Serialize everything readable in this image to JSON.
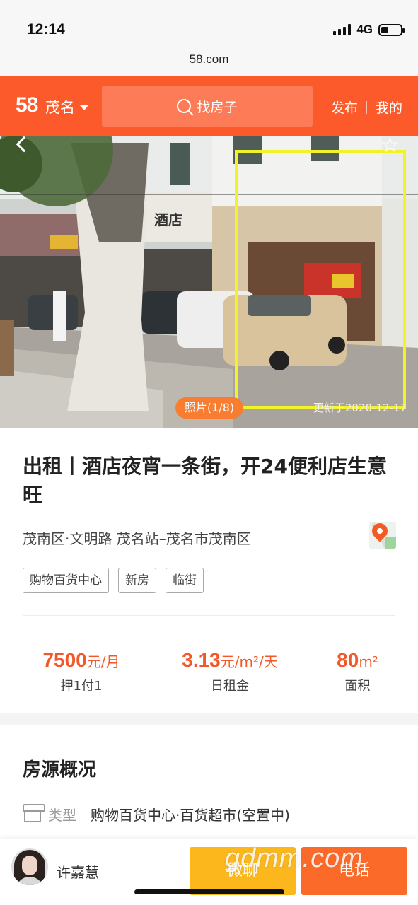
{
  "status": {
    "time": "12:14",
    "network": "4G",
    "battery_level": 0.4
  },
  "browser": {
    "url": "58.com"
  },
  "header": {
    "logo": "58",
    "city": "茂名",
    "search_placeholder": "找房子",
    "publish": "发布",
    "mine": "我的",
    "accent": "#fc5a2a"
  },
  "photo": {
    "counter": "照片(1/8)",
    "updated": "更新于2020-12-17",
    "sign_text": "酒店"
  },
  "listing": {
    "title": "出租丨酒店夜宵一条街，开24便利店生意旺",
    "address": "茂南区·文明路 茂名站–茂名市茂南区",
    "tags": [
      "购物百货中心",
      "新房",
      "临街"
    ]
  },
  "stats": [
    {
      "value": "7500",
      "unit": "元/月",
      "label": "押1付1"
    },
    {
      "value": "3.13",
      "unit": "元/m²/天",
      "label": "日租金"
    },
    {
      "value": "80",
      "unit": "m²",
      "label": "面积"
    }
  ],
  "overview": {
    "title": "房源概况",
    "type_key": "类型",
    "type_value": "购物百货中心·百货超市(空置中)"
  },
  "agent": {
    "name": "许嘉慧"
  },
  "actions": {
    "chat": "微聊",
    "call": "电话"
  },
  "watermark": "gdmm.com"
}
